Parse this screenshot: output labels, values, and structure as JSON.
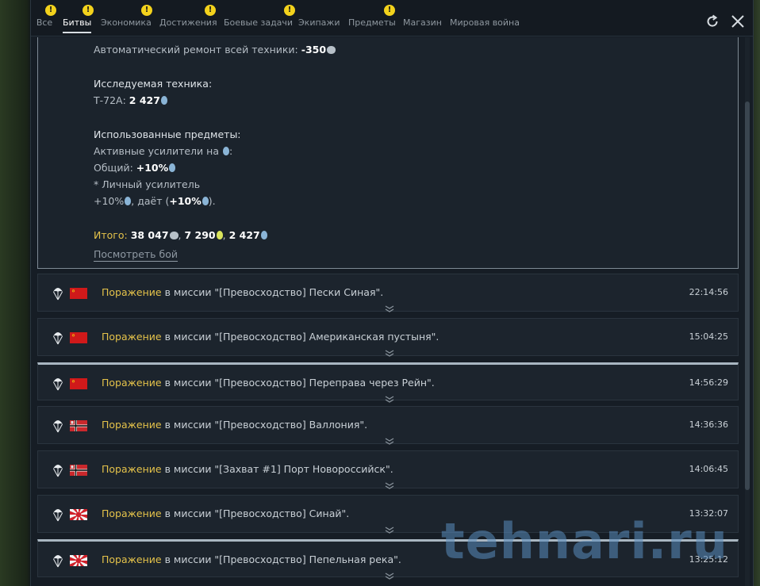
{
  "tabs": [
    {
      "label": "Все",
      "warn": true
    },
    {
      "label": "Битвы",
      "warn": true,
      "active": true
    },
    {
      "label": "Экономика",
      "warn": false
    },
    {
      "label": "Достижения",
      "warn": true
    },
    {
      "label": "Боевые задачи",
      "warn": true
    },
    {
      "label": "Экипажи",
      "warn": false
    },
    {
      "label": "Предметы",
      "warn": true
    },
    {
      "label": "Магазин",
      "warn": false
    },
    {
      "label": "Мировая война",
      "warn": false
    }
  ],
  "warn_glyph": "!",
  "icons": {
    "refresh": "refresh-icon",
    "close": "close-icon",
    "parachute": "parachute-icon",
    "chevron": "double-chevron-down-icon"
  },
  "expanded": {
    "repair": {
      "label": "Автоматический ремонт всей техники: ",
      "value": "-350"
    },
    "research_head": "Исследуемая техника:",
    "research": {
      "label": "Т-72А: ",
      "value": "2 427"
    },
    "items_head": "Использованные предметы:",
    "boosters": "Активные усилители на ",
    "boosters_tail": ":",
    "common": {
      "label": "Общий: ",
      "value": "+10%"
    },
    "personal": "* Личный усилитель",
    "personal_val": {
      "value": "+10%",
      "gives": ", даёт (",
      "gives_value": "+10%",
      "tail": ")."
    },
    "total": {
      "label": "Итого: ",
      "sl": "38 047",
      "gold": "7 290",
      "rp": "2 427",
      "sep": ", "
    },
    "view_battle": "Посмотреть бой"
  },
  "rows": [
    {
      "result": "Поражение",
      "text": " в миссии \"[Превосходство] Пески Синая\".",
      "time": "22:14:56",
      "flag": "ussr",
      "highlight": false
    },
    {
      "result": "Поражение",
      "text": " в миссии \"[Превосходство] Американская пустыня\".",
      "time": "15:04:25",
      "flag": "ussr",
      "highlight": false
    },
    {
      "result": "Поражение",
      "text": " в миссии \"[Превосходство] Переправа через Рейн\".",
      "time": "14:56:29",
      "flag": "ussr",
      "highlight": true
    },
    {
      "result": "Поражение",
      "text": " в миссии \"[Превосходство] Валлония\".",
      "time": "14:36:36",
      "flag": "germany",
      "highlight": false
    },
    {
      "result": "Поражение",
      "text": " в миссии \"[Захват #1] Порт Новороссийск\".",
      "time": "14:06:45",
      "flag": "germany",
      "highlight": false
    },
    {
      "result": "Поражение",
      "text": " в миссии \"[Превосходство] Синай\".",
      "time": "13:32:07",
      "flag": "japan",
      "highlight": false
    },
    {
      "result": "Поражение",
      "text": " в миссии \"[Превосходство] Пепельная река\".",
      "time": "13:25:12",
      "flag": "japan",
      "highlight": true
    }
  ],
  "watermark": "tehnari.ru",
  "colors": {
    "defeat": "#e4c24a",
    "warn": "#f3d21c",
    "rp": "#8ab4d6",
    "gold": "#d9e45c"
  }
}
